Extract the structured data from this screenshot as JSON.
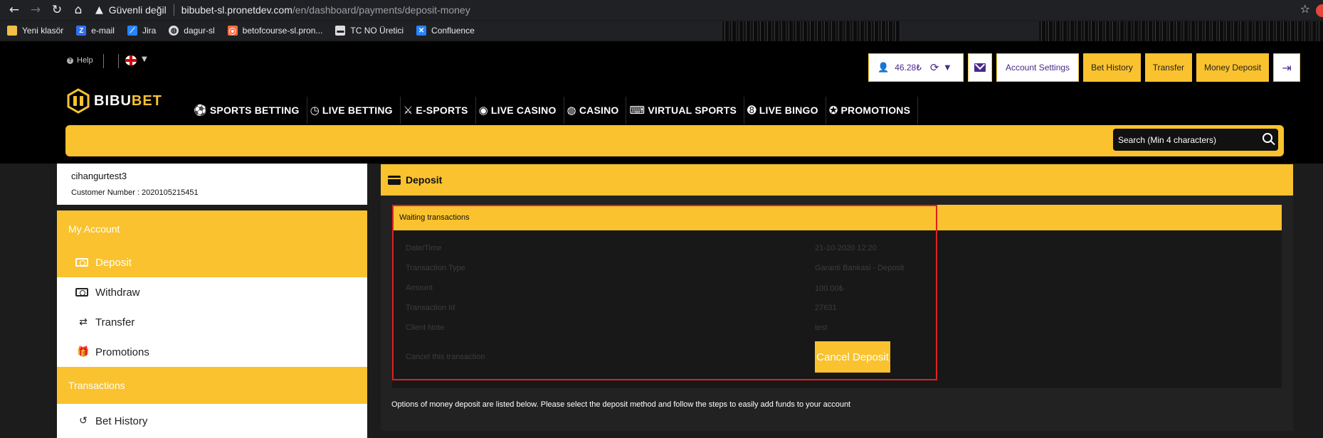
{
  "browser": {
    "security_label": "Güvenli değil",
    "url_host": "bibubet-sl.pronetdev.com",
    "url_path": "/en/dashboard/payments/deposit-money"
  },
  "bookmarks": [
    {
      "label": "Yeni klasör",
      "icon_color": "#f2c046",
      "icon": "folder-icon"
    },
    {
      "label": "e-mail",
      "icon_color": "#2f6ff5",
      "icon": "zimbra-icon"
    },
    {
      "label": "Jira",
      "icon_color": "#2684ff",
      "icon": "jira-icon"
    },
    {
      "label": "dagur-sl",
      "icon_color": "#dddddd",
      "icon": "globe-icon"
    },
    {
      "label": "betofcourse-sl.pron...",
      "icon_color": "#ff6a3d",
      "icon": "site-icon"
    },
    {
      "label": "TC NO Üretici",
      "icon_color": "#dddddd",
      "icon": "id-card-icon"
    },
    {
      "label": "Confluence",
      "icon_color": "#2684ff",
      "icon": "confluence-icon"
    }
  ],
  "header": {
    "help_label": "Help",
    "balance": "46.28₺",
    "account_settings": "Account Settings",
    "bet_history": "Bet History",
    "transfer": "Transfer",
    "money_deposit": "Money Deposit",
    "logo_left": "BIBU",
    "logo_right": "BET",
    "search_placeholder": "Search (Min 4 characters)"
  },
  "nav": [
    {
      "label": "SPORTS BETTING",
      "icon": "soccer-ball-icon",
      "glyph": "⚽"
    },
    {
      "label": "LIVE BETTING",
      "icon": "clock-icon",
      "glyph": "◷"
    },
    {
      "label": "E-SPORTS",
      "icon": "crossed-swords-icon",
      "glyph": "⚔"
    },
    {
      "label": "LIVE CASINO",
      "icon": "chip-icon",
      "glyph": "◉"
    },
    {
      "label": "CASINO",
      "icon": "casino-chip-icon",
      "glyph": "◍"
    },
    {
      "label": "VIRTUAL SPORTS",
      "icon": "gamepad-icon",
      "glyph": "🎮"
    },
    {
      "label": "LIVE BINGO",
      "icon": "bingo-ball-icon",
      "glyph": "➑"
    },
    {
      "label": "PROMOTIONS",
      "icon": "promo-icon",
      "glyph": "✪"
    }
  ],
  "user": {
    "username": "cihangurtest3",
    "customer_number": "Customer Number : 2020105215451"
  },
  "sidebar": {
    "my_account": "My Account",
    "items": [
      {
        "label": "Deposit",
        "active": true
      },
      {
        "label": "Withdraw",
        "active": false
      },
      {
        "label": "Transfer",
        "active": false
      },
      {
        "label": "Promotions",
        "active": false
      }
    ],
    "transactions": "Transactions",
    "transaction_items": [
      {
        "label": "Bet History"
      }
    ]
  },
  "main": {
    "title": "Deposit",
    "waiting_title": "Waiting transactions",
    "rows": [
      {
        "label": "Date/Time",
        "value": "21-10-2020 12:20"
      },
      {
        "label": "Transaction Type",
        "value": "Garanti Bankasi - Deposit"
      },
      {
        "label": "Amount",
        "value": "100.00₺"
      },
      {
        "label": "Transaction Id",
        "value": "27631"
      },
      {
        "label": "Client Note",
        "value": "test"
      }
    ],
    "cancel_label": "Cancel this transaction",
    "cancel_button": "Cancel Deposit",
    "info": "Options of money deposit are listed below. Please select the deposit method and follow the steps to easily add funds to your account"
  },
  "colors": {
    "accent_yellow": "#f9c22e",
    "brand_purple": "#4b2a8c",
    "highlight_red": "#e02020"
  }
}
